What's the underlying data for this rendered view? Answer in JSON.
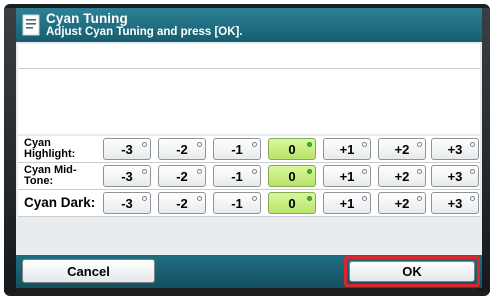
{
  "header": {
    "title": "Cyan Tuning",
    "subtitle": "Adjust Cyan Tuning and press [OK]."
  },
  "rows": [
    {
      "label_line1": "Cyan",
      "label_line2": "Highlight:",
      "options": [
        "-3",
        "-2",
        "-1",
        "0",
        "+1",
        "+2",
        "+3"
      ],
      "selected": "0"
    },
    {
      "label_line1": "Cyan Mid-",
      "label_line2": "Tone:",
      "options": [
        "-3",
        "-2",
        "-1",
        "0",
        "+1",
        "+2",
        "+3"
      ],
      "selected": "0"
    },
    {
      "label_line1": "Cyan Dark:",
      "options": [
        "-3",
        "-2",
        "-1",
        "0",
        "+1",
        "+2",
        "+3"
      ],
      "selected": "0"
    }
  ],
  "footer": {
    "cancel_label": "Cancel",
    "ok_label": "OK"
  },
  "colors": {
    "header": "#1f6f84",
    "selected_button": "#c9ee86",
    "ok_highlight": "#d8282e"
  }
}
